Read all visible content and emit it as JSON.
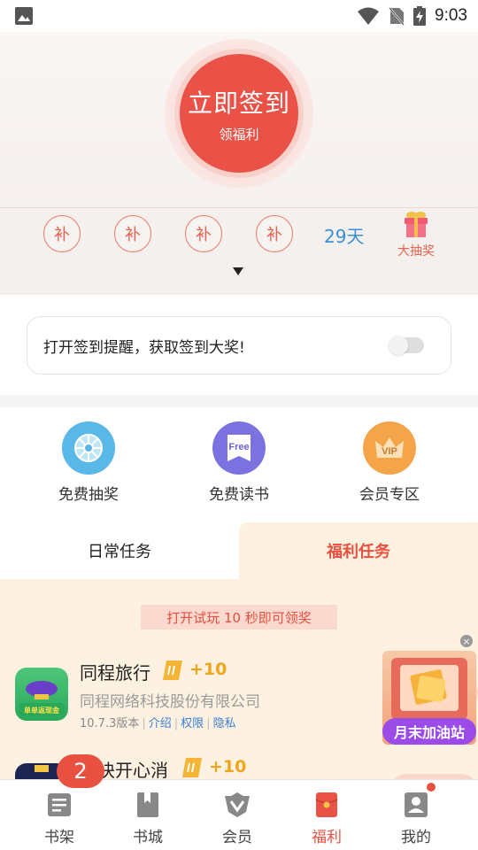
{
  "status_bar": {
    "time": "9:03"
  },
  "checkin": {
    "button_title": "立即签到",
    "button_subtitle": "领福利",
    "makeup_label": "补",
    "days_text": "29天",
    "lottery_label": "大抽奖"
  },
  "reminder": {
    "text": "打开签到提醒，获取签到大奖!",
    "enabled": false
  },
  "features": [
    {
      "label": "免费抽奖",
      "icon": "wheel-icon",
      "color": "#5ab8e8"
    },
    {
      "label": "免费读书",
      "icon": "free-book-icon",
      "color": "#7b72e0",
      "badge": "Free"
    },
    {
      "label": "会员专区",
      "icon": "vip-crown-icon",
      "color": "#f4a54a",
      "badge": "VIP"
    }
  ],
  "tabs": {
    "daily": "日常任务",
    "welfare": "福利任务",
    "active": "welfare"
  },
  "hint": "打开试玩 10 秒即可领奖",
  "tasks": [
    {
      "name": "同程旅行",
      "reward": "+10",
      "company": "同程网络科技股份有限公司",
      "version": "10.7.3版本",
      "links": [
        "介绍",
        "权限",
        "隐私"
      ],
      "icon_text": "单单返现金"
    },
    {
      "name": "方块开心消",
      "reward": "+10"
    }
  ],
  "float_ad": {
    "banner": "月末加油站",
    "close": "×"
  },
  "bottom_nav": {
    "items": [
      {
        "label": "书架",
        "icon": "bookshelf-icon"
      },
      {
        "label": "书城",
        "icon": "bookstore-icon"
      },
      {
        "label": "会员",
        "icon": "member-icon"
      },
      {
        "label": "福利",
        "icon": "welfare-icon"
      },
      {
        "label": "我的",
        "icon": "profile-icon"
      }
    ],
    "active": "福利",
    "badge": "2"
  },
  "colors": {
    "accent": "#e8503f",
    "link": "#3b7fd4",
    "reward": "#f0a51a",
    "panel": "#fdf2e2"
  }
}
